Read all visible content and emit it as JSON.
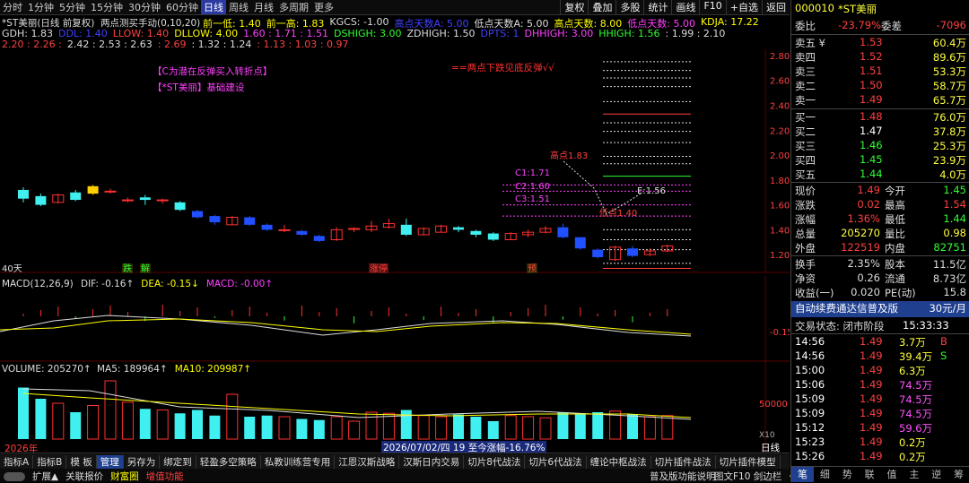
{
  "toolbar": {
    "periods": [
      "分时",
      "1分钟",
      "5分钟",
      "15分钟",
      "30分钟",
      "60分钟",
      "日线",
      "周线",
      "月线",
      "多周期",
      "更多"
    ],
    "active": "日线",
    "right": [
      "复权",
      "叠加",
      "多股",
      "统计",
      "画线",
      "F10",
      "+自选",
      "返回"
    ]
  },
  "chart": {
    "title": "*ST美丽(日线 前复权)",
    "indicator_name": "两点测买手动(0,10,20)",
    "info1": [
      {
        "t": "前一低: 1.40",
        "c": "#ff0"
      },
      {
        "t": "前一高: 1.83",
        "c": "#ff0"
      },
      {
        "t": "KGCS: -1.00",
        "c": "#ddd"
      },
      {
        "t": "高点天数A: 5.00",
        "c": "#4040ff"
      },
      {
        "t": "低点天数A: 5.00",
        "c": "#ddd"
      },
      {
        "t": "高点天数: 8.00",
        "c": "#ff0"
      },
      {
        "t": "低点天数: 5.00",
        "c": "#ff40ff"
      },
      {
        "t": "KDJA: 17.22",
        "c": "#ff0"
      }
    ],
    "info2": [
      {
        "t": "GDH: 1.83",
        "c": "#ddd"
      },
      {
        "t": "DDL: 1.40",
        "c": "#4040ff"
      },
      {
        "t": "LLOW: 1.40",
        "c": "#ff4040"
      },
      {
        "t": "DLLOW: 4.00",
        "c": "#ff0"
      },
      {
        "t": "1.60 : 1.71 : 1.51",
        "c": "#ff40ff"
      },
      {
        "t": "DSHIGH: 3.00",
        "c": "#30ff30"
      },
      {
        "t": "ZDHIGH: 1.50",
        "c": "#ddd"
      },
      {
        "t": "DPTS: 1",
        "c": "#4040ff"
      },
      {
        "t": "DHHIGH: 3.00",
        "c": "#ff40ff"
      },
      {
        "t": "HHIGH: 1.56",
        "c": "#30ff30"
      },
      {
        "t": ": 1.99 : 2.10",
        "c": "#ddd"
      }
    ],
    "info3": [
      {
        "t": "2.20 : 2.26 :",
        "c": "#ff4040"
      },
      {
        "t": "2.42 : 2.53 : 2.63",
        "c": "#ddd"
      },
      {
        "t": ": 2.69",
        "c": "#ff4040"
      },
      {
        "t": ": 1.32 : 1.24",
        "c": "#ddd"
      },
      {
        "t": ": 1.13 : 1.03 : 0.97",
        "c": "#ff4040"
      }
    ],
    "notes": [
      {
        "t": "【C为潜在反弹买入转折点】",
        "c": "#ff40ff"
      },
      {
        "t": "【*ST美丽】基础建设",
        "c": "#ff40ff"
      },
      {
        "t": "==两点下跌见底反弹√√",
        "c": "#ff3030"
      }
    ],
    "annot": [
      "高点1.83",
      "C1:1.71",
      "C2:1.60",
      "C3:1.51",
      "E:1.56",
      "低点1.40"
    ],
    "price_ticks": [
      "2.80",
      "2.60",
      "2.40",
      "2.20",
      "2.00",
      "1.80",
      "1.60",
      "1.40",
      "1.20"
    ],
    "footer_labels": [
      "40天",
      "跌",
      "解",
      "涨停",
      "预"
    ],
    "macd_label": "MACD(12,26,9)",
    "macd_vals": [
      {
        "t": "DIF: -0.16↑",
        "c": "#ddd"
      },
      {
        "t": "DEA: -0.15↓",
        "c": "#ff0"
      },
      {
        "t": "MACD: -0.00↑",
        "c": "#ff40ff"
      }
    ],
    "macd_tick": "-0.15",
    "vol_label": "VOLUME: 205270↑",
    "vol_vals": [
      {
        "t": "MA5: 189964↑",
        "c": "#ddd"
      },
      {
        "t": "MA10: 209987↑",
        "c": "#ff0"
      }
    ],
    "vol_tick": "50000",
    "vol_unit": "X10",
    "vol_bottom_left": "2026年",
    "vol_date": "2026/07/02/四 19 至今涨幅-16.76%",
    "period_btn": "日线"
  },
  "bottom": {
    "tabs1": [
      "指标A",
      "指标B",
      "模 板",
      "管理",
      "另存为",
      "绑定到",
      "轻盈多空策略",
      "私教训练营专用",
      "江恩汉斯战略",
      "汉斯日内交易",
      "切片8代战法",
      "切片6代战法",
      "缠论中枢战法",
      "切片插件战法",
      "切片插件模型"
    ],
    "active": "管理",
    "tabs2": [
      {
        "t": "扩展▲",
        "c": "#ddd"
      },
      {
        "t": "关联报价",
        "c": "#ddd"
      },
      {
        "t": "财富圈",
        "c": "#ff0"
      },
      {
        "t": "增值功能",
        "c": "#ff4040"
      }
    ],
    "right2": "普及版功能说明",
    "right3": "图文F10 剑边栏 《"
  },
  "side": {
    "code": "000010",
    "name": "*ST美丽",
    "weibi_label": "委比",
    "weibi": "-23.79%",
    "weicha_label": "委差",
    "weicha": "-7096",
    "asks": [
      {
        "l": "卖五 ¥",
        "p": "1.53",
        "v": "60.4万"
      },
      {
        "l": "卖四",
        "p": "1.52",
        "v": "89.6万"
      },
      {
        "l": "卖三",
        "p": "1.51",
        "v": "53.3万"
      },
      {
        "l": "卖二",
        "p": "1.50",
        "v": "58.7万"
      },
      {
        "l": "卖一",
        "p": "1.49",
        "v": "65.7万"
      }
    ],
    "bids": [
      {
        "l": "买一",
        "p": "1.48",
        "v": "76.0万",
        "c": "red"
      },
      {
        "l": "买二",
        "p": "1.47",
        "v": "37.8万",
        "c": "wht"
      },
      {
        "l": "买三",
        "p": "1.46",
        "v": "25.3万",
        "c": "grn"
      },
      {
        "l": "买四",
        "p": "1.45",
        "v": "23.9万",
        "c": "grn"
      },
      {
        "l": "买五",
        "p": "1.44",
        "v": "4.0万",
        "c": "grn"
      }
    ],
    "quote": [
      {
        "l": "现价",
        "v": "1.49",
        "l2": "今开",
        "v2": "1.45",
        "c1": "red",
        "c2": "grn"
      },
      {
        "l": "涨跌",
        "v": "0.02",
        "l2": "最高",
        "v2": "1.54",
        "c1": "red",
        "c2": "red"
      },
      {
        "l": "涨幅",
        "v": "1.36%",
        "l2": "最低",
        "v2": "1.44",
        "c1": "red",
        "c2": "grn"
      },
      {
        "l": "总量",
        "v": "205270",
        "l2": "量比",
        "v2": "0.98",
        "c1": "yel",
        "c2": "yel"
      },
      {
        "l": "外盘",
        "v": "122519",
        "l2": "内盘",
        "v2": "82751",
        "c1": "red",
        "c2": "grn"
      }
    ],
    "stats": [
      {
        "l": "换手",
        "v": "2.35%",
        "l2": "股本",
        "v2": "11.5亿"
      },
      {
        "l": "净资",
        "v": "0.26",
        "l2": "流通",
        "v2": "8.73亿"
      },
      {
        "l": "收益(一)",
        "v": "0.020",
        "l2": "PE(动)",
        "v2": "15.8"
      }
    ],
    "ad": "自动续费通达信普及版",
    "ad_price": "30元/月",
    "status": "交易状态: 闭市阶段",
    "status_time": "15:33:33",
    "ticks": [
      {
        "t": "14:56",
        "p": "1.49",
        "v": "3.7万",
        "s": "B"
      },
      {
        "t": "14:56",
        "p": "1.49",
        "v": "39.4万",
        "s": "S"
      },
      {
        "t": "15:00",
        "p": "1.49",
        "v": "6.3万",
        "s": ""
      },
      {
        "t": "15:06",
        "p": "1.49",
        "v": "74.5万",
        "s": ""
      },
      {
        "t": "15:09",
        "p": "1.49",
        "v": "74.5万",
        "s": ""
      },
      {
        "t": "15:09",
        "p": "1.49",
        "v": "74.5万",
        "s": ""
      },
      {
        "t": "15:12",
        "p": "1.49",
        "v": "59.6万",
        "s": ""
      },
      {
        "t": "15:23",
        "p": "1.49",
        "v": "0.2万",
        "s": ""
      },
      {
        "t": "15:26",
        "p": "1.49",
        "v": "0.2万",
        "s": ""
      }
    ],
    "tabs": [
      "笔",
      "细",
      "势",
      "联",
      "值",
      "主",
      "逆",
      "筹"
    ]
  },
  "chart_data": {
    "type": "candlestick",
    "candles": [
      [
        1.72,
        1.65,
        1.74,
        1.62
      ],
      [
        1.67,
        1.6,
        1.69,
        1.59
      ],
      [
        1.62,
        1.68,
        1.69,
        1.61
      ],
      [
        1.7,
        1.64,
        1.72,
        1.63
      ],
      [
        1.69,
        1.75,
        1.76,
        1.68
      ],
      [
        1.71,
        1.71,
        1.73,
        1.69
      ],
      [
        1.64,
        1.64,
        1.66,
        1.62
      ],
      [
        1.66,
        1.64,
        1.68,
        1.6
      ],
      [
        1.64,
        1.64,
        1.65,
        1.61
      ],
      [
        1.62,
        1.56,
        1.63,
        1.55
      ],
      [
        1.55,
        1.5,
        1.56,
        1.49
      ],
      [
        1.51,
        1.46,
        1.52,
        1.44
      ],
      [
        1.44,
        1.5,
        1.51,
        1.44
      ],
      [
        1.5,
        1.44,
        1.51,
        1.43
      ],
      [
        1.44,
        1.4,
        1.45,
        1.39
      ],
      [
        1.4,
        1.4,
        1.44,
        1.38
      ],
      [
        1.39,
        1.36,
        1.4,
        1.35
      ],
      [
        1.35,
        1.31,
        1.36,
        1.3
      ],
      [
        1.32,
        1.4,
        1.42,
        1.31
      ],
      [
        1.41,
        1.41,
        1.42,
        1.38
      ],
      [
        1.4,
        1.43,
        1.47,
        1.38
      ],
      [
        1.42,
        1.45,
        1.49,
        1.41
      ],
      [
        1.44,
        1.36,
        1.49,
        1.35
      ],
      [
        1.36,
        1.41,
        1.42,
        1.36
      ],
      [
        1.38,
        1.43,
        1.44,
        1.38
      ],
      [
        1.42,
        1.4,
        1.43,
        1.38
      ],
      [
        1.39,
        1.36,
        1.4,
        1.34
      ],
      [
        1.37,
        1.32,
        1.38,
        1.31
      ],
      [
        1.32,
        1.37,
        1.38,
        1.32
      ],
      [
        1.36,
        1.38,
        1.4,
        1.34
      ],
      [
        1.38,
        1.41,
        1.43,
        1.37
      ],
      [
        1.42,
        1.34,
        1.45,
        1.33
      ],
      [
        1.34,
        1.25,
        1.34,
        1.24
      ],
      [
        1.24,
        1.18,
        1.25,
        1.17
      ],
      [
        1.16,
        1.26,
        1.27,
        1.15
      ],
      [
        1.25,
        1.19,
        1.27,
        1.18
      ],
      [
        1.2,
        1.23,
        1.25,
        1.19
      ],
      [
        1.23,
        1.27,
        1.28,
        1.22
      ]
    ],
    "volume": [
      230,
      180,
      160,
      120,
      150,
      260,
      165,
      135,
      130,
      115,
      130,
      105,
      200,
      100,
      105,
      100,
      90,
      85,
      100,
      80,
      120,
      115,
      130,
      105,
      100,
      110,
      100,
      80,
      105,
      100,
      95,
      120,
      115,
      120,
      125,
      110,
      100,
      105
    ]
  }
}
